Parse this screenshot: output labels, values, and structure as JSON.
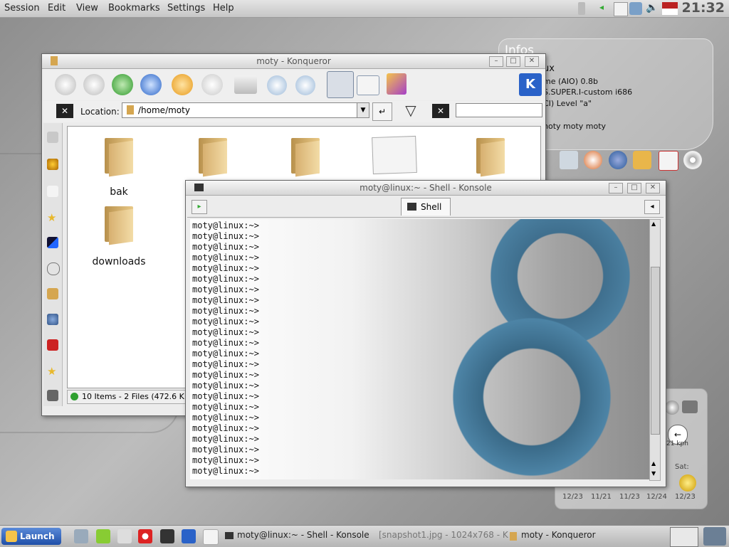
{
  "menubar": {
    "items": [
      "Session",
      "Edit",
      "View",
      "Bookmarks",
      "Settings",
      "Help"
    ],
    "clock": "21:32"
  },
  "infos": {
    "title": "Infos",
    "lines": [
      "ux",
      "me (AIO) 0.8b",
      "S.SUPER.I-custom i686",
      "CI) Level \"a\"",
      "hoty moty moty"
    ]
  },
  "konqueror": {
    "title": "moty - Konqueror",
    "location_label": "Location:",
    "location_value": "/home/moty",
    "folders": [
      {
        "name": "bak"
      },
      {
        "name": "downloads"
      }
    ],
    "status": "10 Items - 2 Files (472.6 K"
  },
  "konsole": {
    "title": "moty@linux:~ - Shell - Konsole",
    "tab_label": "Shell",
    "lines": [
      "moty@linux:~>",
      "moty@linux:~>",
      "moty@linux:~>",
      "moty@linux:~>",
      "moty@linux:~>",
      "moty@linux:~>",
      "moty@linux:~>",
      "moty@linux:~>",
      "moty@linux:~>",
      "moty@linux:~>",
      "moty@linux:~>",
      "moty@linux:~>",
      "moty@linux:~>",
      "moty@linux:~>",
      "moty@linux:~>",
      "moty@linux:~>",
      "moty@linux:~>",
      "moty@linux:~>",
      "moty@linux:~>",
      "moty@linux:~>",
      "moty@linux:~>",
      "moty@linux:~>",
      "moty@linux:~>",
      "moty@linux:~>"
    ]
  },
  "weather": {
    "speed": "21 kph",
    "day": "Sat:",
    "dates": [
      "12/23",
      "11/21",
      "11/23",
      "12/24",
      "12/23"
    ]
  },
  "taskbar": {
    "launch_label": "Launch",
    "tasks": [
      "moty@linux:~ - Shell - Konsole",
      "[snapshot1.jpg - 1024x768 - K",
      "moty - Konqueror"
    ]
  },
  "colors": {
    "accent": "#1f4fa8",
    "gear": "#3f6f8e"
  }
}
